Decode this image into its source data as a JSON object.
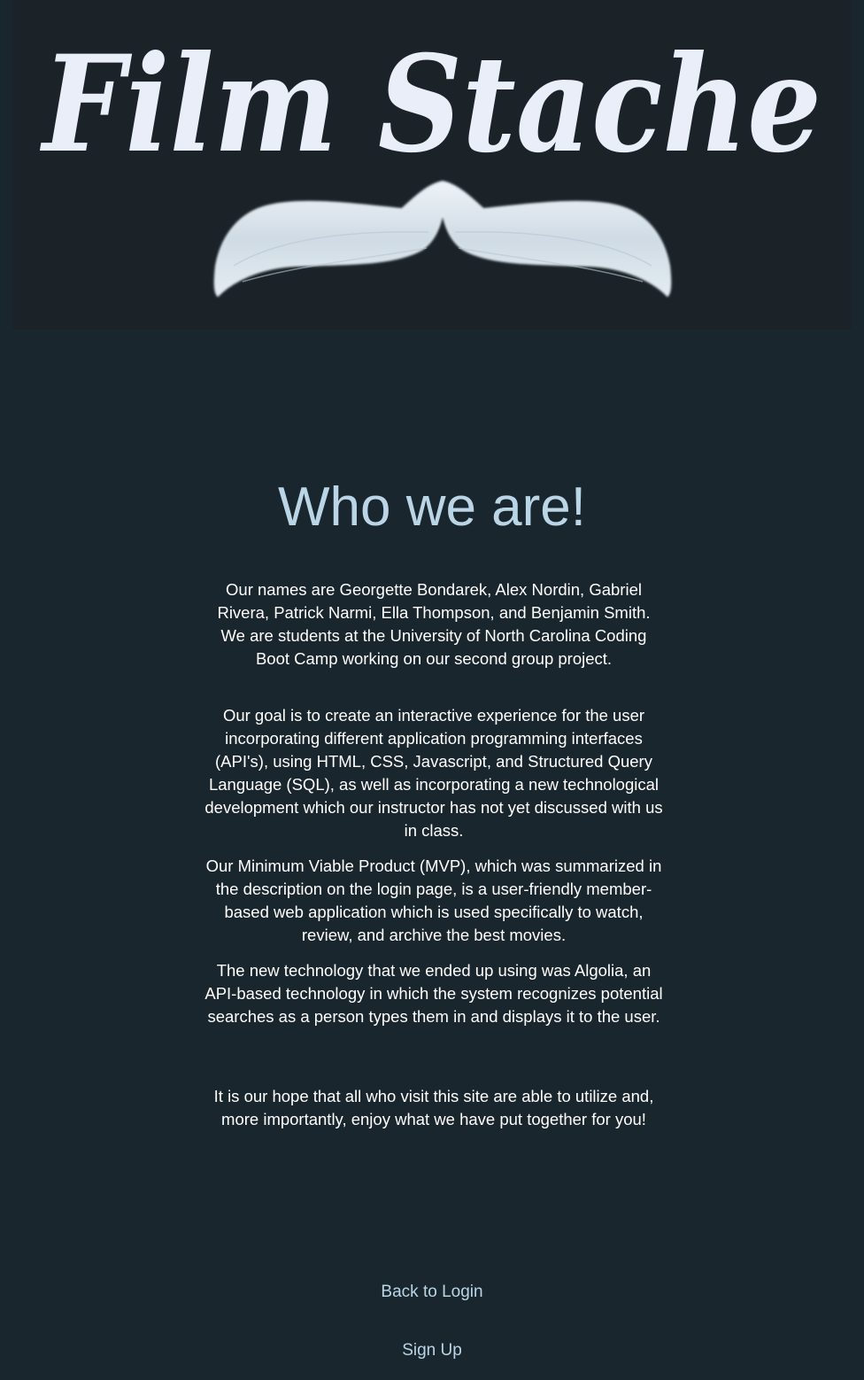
{
  "logo": {
    "text": "Film Stache",
    "icon": "mustache-icon"
  },
  "main": {
    "heading": "Who we are!",
    "paragraphs": [
      "Our names are Georgette Bondarek, Alex Nordin, Gabriel Rivera, Patrick Narmi, Ella Thompson, and Benjamin Smith. We are students at the University of North Carolina Coding Boot Camp working on our second group project.",
      "Our goal is to create an interactive experience for the user incorporating different application programming interfaces (API's), using HTML, CSS, Javascript, and Structured Query Language (SQL), as well as incorporating a new technological development which our instructor has not yet discussed with us in class.",
      "Our Minimum Viable Product (MVP), which was summarized in the description on the login page, is a user-friendly member-based web application which is used specifically to watch, review, and archive the best movies.",
      "The new technology that we ended up using was Algolia, an API-based technology in which the system recognizes potential searches as a person types them in and displays it to the user.",
      "It is our hope that all who visit this site are able to utilize and, more importantly, enjoy what we have put together for you!"
    ]
  },
  "nav": {
    "back_to_login": "Back to Login",
    "sign_up": "Sign Up"
  },
  "colors": {
    "background": "#1a262d",
    "header_background": "#1b2329",
    "logo": "#e9eef8",
    "accent": "#b9d5e6",
    "text": "#ffffff"
  }
}
